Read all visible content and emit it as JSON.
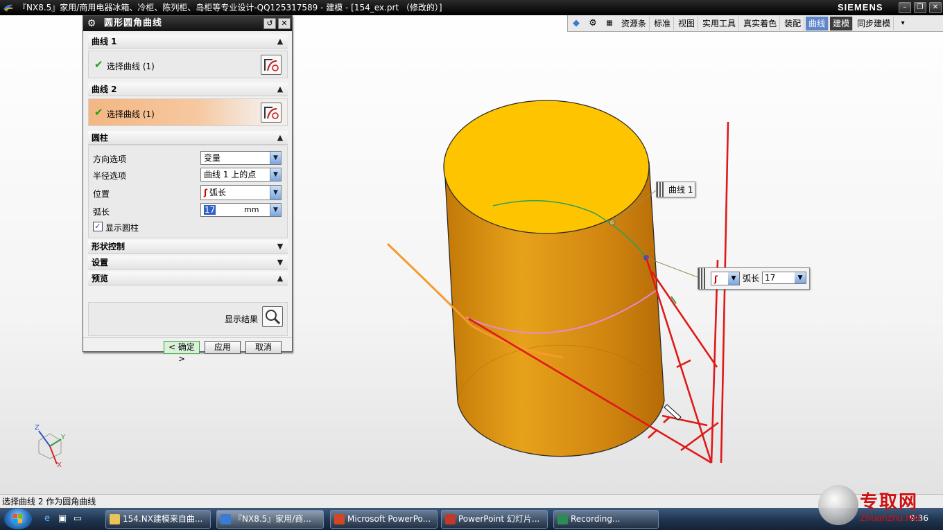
{
  "window": {
    "title": "『NX8.5』家用/商用电器冰箱、冷柜、陈列柜、岛柜等专业设计-QQ125317589 - 建模 - [154_ex.prt （修改的）]",
    "brand": "SIEMENS"
  },
  "toolbar": {
    "items": [
      "资源条",
      "标准",
      "视图",
      "实用工具",
      "真实着色",
      "装配",
      "曲线",
      "建模",
      "同步建模"
    ],
    "active": "曲线"
  },
  "dialog": {
    "title": "圆形圆角曲线",
    "curve1": {
      "header": "曲线 1",
      "select_label": "选择曲线 (1)"
    },
    "curve2": {
      "header": "曲线 2",
      "select_label": "选择曲线 (1)"
    },
    "cylinder": {
      "header": "圆柱",
      "direction_label": "方向选项",
      "direction_value": "变量",
      "radius_label": "半径选项",
      "radius_value": "曲线 1 上的点",
      "position_label": "位置",
      "position_value": "弧长",
      "arclength_label": "弧长",
      "arclength_value": "17",
      "arclength_unit": "mm",
      "show_cylinder_label": "显示圆柱",
      "show_cylinder_checked": true
    },
    "shape_control_header": "形状控制",
    "settings_header": "设置",
    "preview": {
      "header": "预览",
      "show_result_label": "显示结果"
    },
    "buttons": {
      "ok": "< 确定 >",
      "apply": "应用",
      "cancel": "取消"
    }
  },
  "viewport": {
    "curve1_tag": "曲线 1",
    "arclength_tag": {
      "label": "弧长",
      "value": "17"
    },
    "triad": {
      "x": "X",
      "y": "Y",
      "z": "Z"
    }
  },
  "status": {
    "prompt": "选择曲线 2 作为圆角曲线"
  },
  "taskbar": {
    "tasks": [
      "154.NX建模来自曲...",
      "『NX8.5』家用/商...",
      "Microsoft PowerPo...",
      "PowerPoint 幻灯片...",
      "Recording..."
    ],
    "clock": "9:36"
  },
  "watermark": {
    "text": "专取网",
    "url": "Zhuanzhu.Net"
  },
  "colors": {
    "accent": "#5f86c8",
    "cylinder": "#e29a10",
    "cylinder_top": "#ffc400",
    "sketch_lines": "#e01818",
    "selected_curve": "#f59b2e"
  }
}
